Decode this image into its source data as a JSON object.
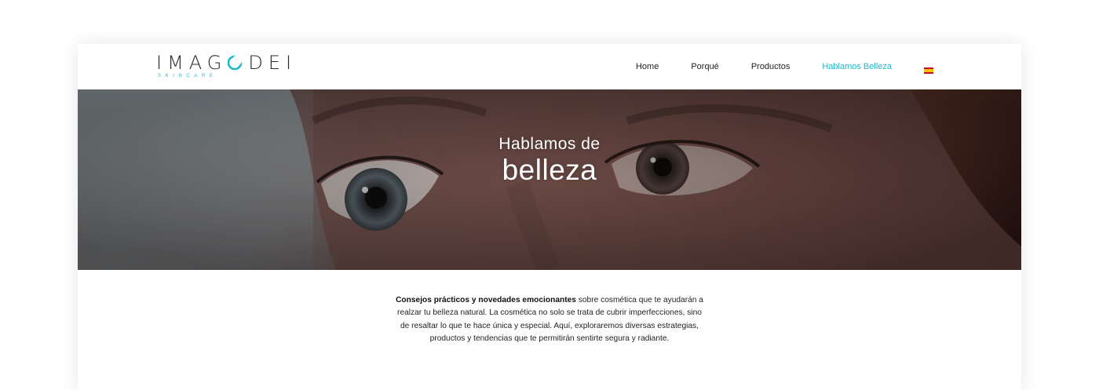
{
  "brand": {
    "name_before": "IMAG",
    "name_after": "DEI",
    "tagline": "SKINCARE",
    "accent_color": "#1fb8ca"
  },
  "nav": {
    "items": [
      {
        "label": "Home",
        "active": false
      },
      {
        "label": "Porqué",
        "active": false
      },
      {
        "label": "Productos",
        "active": false
      },
      {
        "label": "Hablamos Belleza",
        "active": true
      }
    ],
    "language_icon": "spain-flag-icon"
  },
  "hero": {
    "title_line1": "Hablamos de",
    "title_line2": "belleza",
    "image": "close-up-eyes-photo"
  },
  "intro": {
    "bold": "Consejos prácticos y novedades emocionantes",
    "text": " sobre cosmética que te ayudarán a realzar tu belleza natural. La cosmética no solo se trata de cubrir imperfecciones, sino de resaltar lo que te hace única y especial. Aquí, exploraremos diversas estrategias, productos y tendencias que te permitirán sentirte segura y radiante."
  }
}
